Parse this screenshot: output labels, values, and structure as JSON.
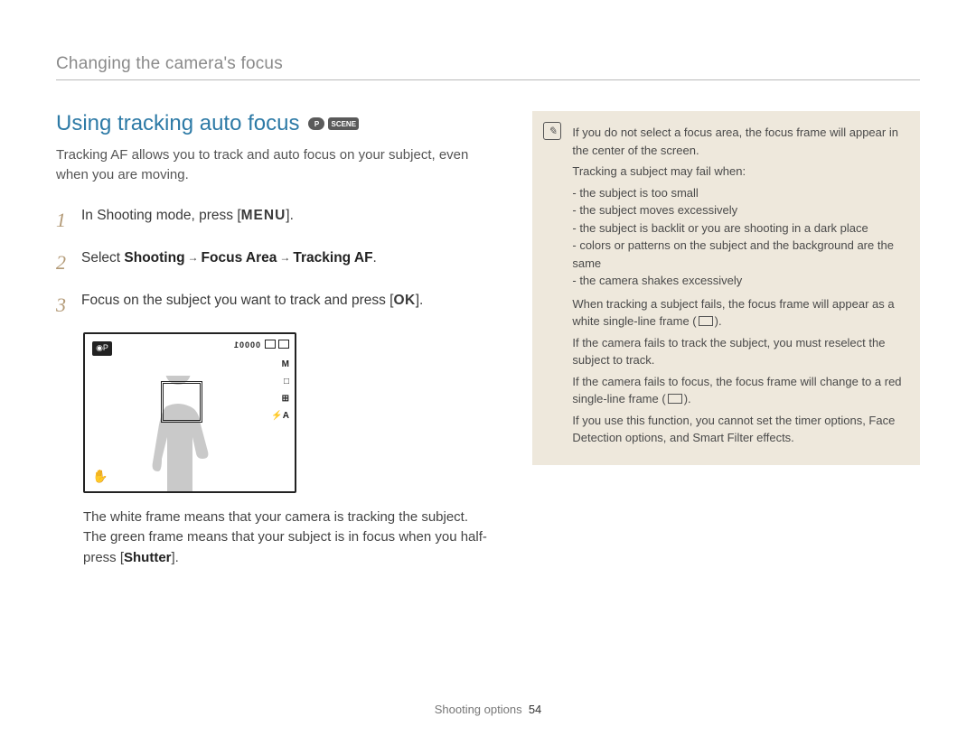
{
  "breadcrumb": "Changing the camera's focus",
  "heading": "Using tracking auto focus",
  "mode_icons": [
    "P",
    "SCENE"
  ],
  "intro": "Tracking AF allows you to track and auto focus on your subject, even when you are moving.",
  "steps": {
    "s1": {
      "num": "1",
      "pre": "In Shooting mode, press [",
      "btn": "MENU",
      "post": "]."
    },
    "s2": {
      "num": "2",
      "pre": "Select ",
      "b1": "Shooting",
      "b2": "Focus Area",
      "b3": "Tracking AF",
      "post": "."
    },
    "s3": {
      "num": "3",
      "pre": "Focus on the subject you want to track and press [",
      "btn": "OK",
      "post": "]."
    }
  },
  "lcd": {
    "counter": "00001",
    "side": [
      "M",
      "□",
      "⊞",
      "⚡A"
    ],
    "cam_label": "◉P",
    "hand_label": "✋"
  },
  "explain": {
    "l1": "The white frame means that your camera is tracking the subject.",
    "l2a": "The green frame means that your subject is in focus when you half-press [",
    "l2b": "Shutter",
    "l2c": "]."
  },
  "note": {
    "p1": "If you do not select a focus area, the focus frame will appear in the center of the screen.",
    "p2": "Tracking a subject may fail when:",
    "bullets": [
      "the subject is too small",
      "the subject moves excessively",
      "the subject is backlit or you are shooting in a dark place",
      "colors or patterns on the subject and the background are the same",
      "the camera shakes excessively"
    ],
    "p3a": "When tracking a subject fails, the focus frame will appear as a white single-line frame (",
    "p3b": ").",
    "p4": "If the camera fails to track the subject, you must reselect the subject to track.",
    "p5a": "If the camera fails to focus, the focus frame will change to a red single-line frame (",
    "p5b": ").",
    "p6": "If you use this function, you cannot set the timer options, Face Detection options, and Smart Filter effects."
  },
  "footer": {
    "section": "Shooting options",
    "page": "54"
  }
}
